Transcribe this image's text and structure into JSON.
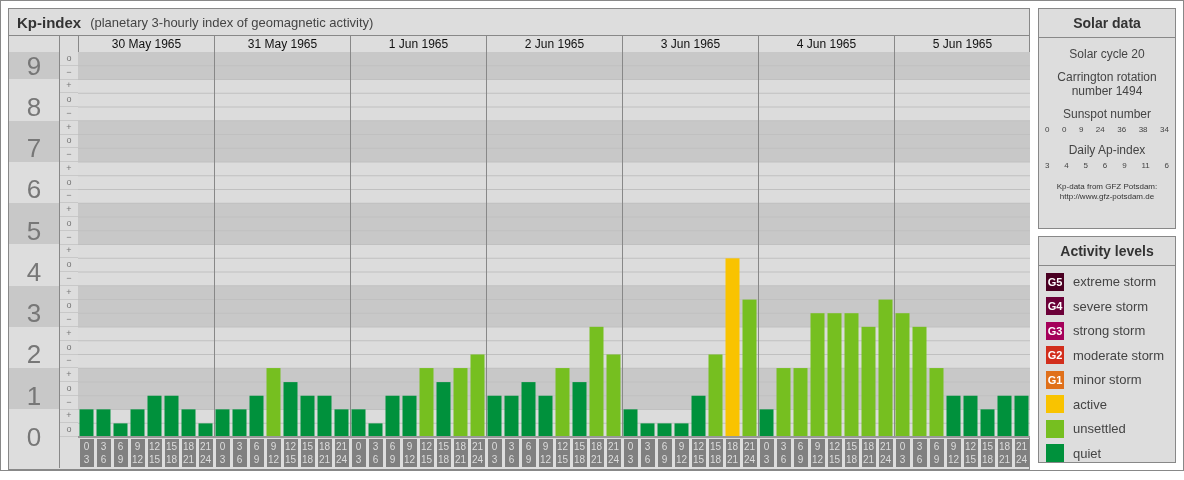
{
  "kp_panel": {
    "title": "Kp-index",
    "subtitle": "(planetary 3-hourly index of geomagnetic activity)",
    "dates": [
      "30 May 1965",
      "31 May 1965",
      "1 Jun 1965",
      "2 Jun 1965",
      "3 Jun 1965",
      "4 Jun 1965",
      "5 Jun 1965"
    ],
    "sub_levels": [
      "o",
      "−",
      "+",
      "o",
      "−",
      "+",
      "o",
      "−",
      "+",
      "o",
      "−",
      "+",
      "o",
      "−",
      "+",
      "o",
      "−",
      "+",
      "o",
      "−",
      "+",
      "o",
      "−",
      "+",
      "o",
      "−",
      "+",
      "o"
    ],
    "chart_data": {
      "type": "bar",
      "stacked": true,
      "grid": true,
      "ylim": [
        0,
        9.33
      ],
      "yticks": [
        0,
        1,
        2,
        3,
        4,
        5,
        6,
        7,
        8,
        9
      ],
      "categories": [
        "0\n3",
        "3\n6",
        "6\n9",
        "9\n12",
        "12\n15",
        "15\n18",
        "18\n21",
        "21\n24",
        "0\n3",
        "3\n6",
        "6\n9",
        "9\n12",
        "12\n15",
        "15\n18",
        "18\n21",
        "21\n24",
        "0\n3",
        "3\n6",
        "6\n9",
        "9\n12",
        "12\n15",
        "15\n18",
        "18\n21",
        "21\n24",
        "0\n3",
        "3\n6",
        "6\n9",
        "9\n12",
        "12\n15",
        "15\n18",
        "18\n21",
        "21\n24",
        "0\n3",
        "3\n6",
        "6\n9",
        "9\n12",
        "12\n15",
        "15\n18",
        "18\n21",
        "21\n24",
        "0\n3",
        "3\n6",
        "6\n9",
        "9\n12",
        "12\n15",
        "15\n18",
        "18\n21",
        "21\n24",
        "0\n3",
        "3\n6",
        "6\n9",
        "9\n12",
        "12\n15",
        "15\n18",
        "18\n21",
        "21\n24"
      ],
      "series": [
        {
          "color": "#00913c",
          "values": [
            0.67,
            0.67,
            0.33,
            0.67,
            1,
            1,
            0.67,
            0.33,
            0.67,
            0.67,
            1,
            null,
            1.33,
            1,
            1,
            0.67,
            0.67,
            0.33,
            1,
            1,
            null,
            1.33,
            null,
            null,
            1,
            1,
            1.33,
            1,
            null,
            1.33,
            null,
            null,
            0.67,
            0.33,
            0.33,
            0.33,
            1,
            null,
            null,
            null,
            0.67,
            null,
            null,
            null,
            null,
            null,
            null,
            null,
            null,
            null,
            null,
            1,
            1,
            0.67,
            1,
            1
          ]
        },
        {
          "color": "#76bf20",
          "values": [
            null,
            null,
            null,
            null,
            null,
            null,
            null,
            null,
            null,
            null,
            null,
            1.67,
            null,
            null,
            null,
            null,
            null,
            null,
            null,
            null,
            1.67,
            null,
            1.67,
            2,
            null,
            null,
            null,
            null,
            1.67,
            null,
            2.67,
            2,
            null,
            null,
            null,
            null,
            null,
            2,
            null,
            3.33,
            null,
            1.67,
            1.67,
            3,
            3,
            3,
            2.67,
            3.33,
            3,
            2.67,
            1.67,
            null,
            null,
            null,
            null,
            null
          ]
        },
        {
          "color": "#f9c300",
          "values": [
            null,
            null,
            null,
            null,
            null,
            null,
            null,
            null,
            null,
            null,
            null,
            null,
            null,
            null,
            null,
            null,
            null,
            null,
            null,
            null,
            null,
            null,
            null,
            null,
            null,
            null,
            null,
            null,
            null,
            null,
            null,
            null,
            null,
            null,
            null,
            null,
            null,
            null,
            4.33,
            null,
            null,
            null,
            null,
            null,
            null,
            null,
            null,
            null,
            null,
            null,
            null,
            null,
            null,
            null,
            null,
            null
          ]
        }
      ]
    }
  },
  "solar_data": {
    "title": "Solar data",
    "solar_cycle": "Solar cycle 20",
    "carrington": "Carrington rotation number 1494",
    "sunspot_label": "Sunspot number",
    "sunspot_numbers": [
      "0",
      "0",
      "9",
      "24",
      "36",
      "38",
      "34"
    ],
    "ap_label": "Daily Ap-index",
    "ap_values": [
      "3",
      "4",
      "5",
      "6",
      "9",
      "11",
      "6"
    ],
    "source": "Kp-data from GFZ Potsdam:",
    "source_link": "http://www.gfz-potsdam.de"
  },
  "activity_levels": {
    "title": "Activity levels",
    "items": [
      {
        "code": "G5",
        "label": "extreme storm",
        "color": "#4a0022"
      },
      {
        "code": "G4",
        "label": "severe storm",
        "color": "#6b0038"
      },
      {
        "code": "G3",
        "label": "strong storm",
        "color": "#a5005a"
      },
      {
        "code": "G2",
        "label": "moderate storm",
        "color": "#d22e1c"
      },
      {
        "code": "G1",
        "label": "minor storm",
        "color": "#e0701a"
      },
      {
        "label": "active",
        "color": "#f9c300"
      },
      {
        "label": "unsettled",
        "color": "#76bf20"
      },
      {
        "label": "quiet",
        "color": "#00913c"
      }
    ]
  }
}
